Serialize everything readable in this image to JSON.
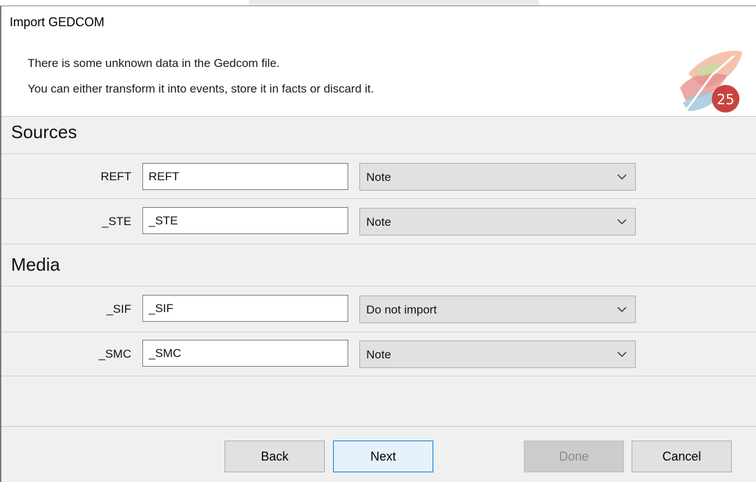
{
  "window": {
    "title": "Import GEDCOM"
  },
  "header": {
    "intro_line_1": "There is some unknown data in the Gedcom file.",
    "intro_line_2": "You can either transform it into events, store it in facts or discard it.",
    "logo_icon": "tree-25-logo-icon"
  },
  "sections": [
    {
      "heading": "Sources",
      "rows": [
        {
          "label": "REFT",
          "field_value": "REFT",
          "option": "Note"
        },
        {
          "label": "_STE",
          "field_value": "_STE",
          "option": "Note"
        }
      ]
    },
    {
      "heading": "Media",
      "rows": [
        {
          "label": "_SIF",
          "field_value": "_SIF",
          "option": "Do not import"
        },
        {
          "label": "_SMC",
          "field_value": "_SMC",
          "option": "Note"
        }
      ]
    }
  ],
  "buttons": {
    "back": "Back",
    "next": "Next",
    "done": "Done",
    "cancel": "Cancel"
  },
  "colors": {
    "accent": "#0078d7",
    "dialog_bg": "#f0f0f0",
    "header_bg": "#ffffff"
  }
}
